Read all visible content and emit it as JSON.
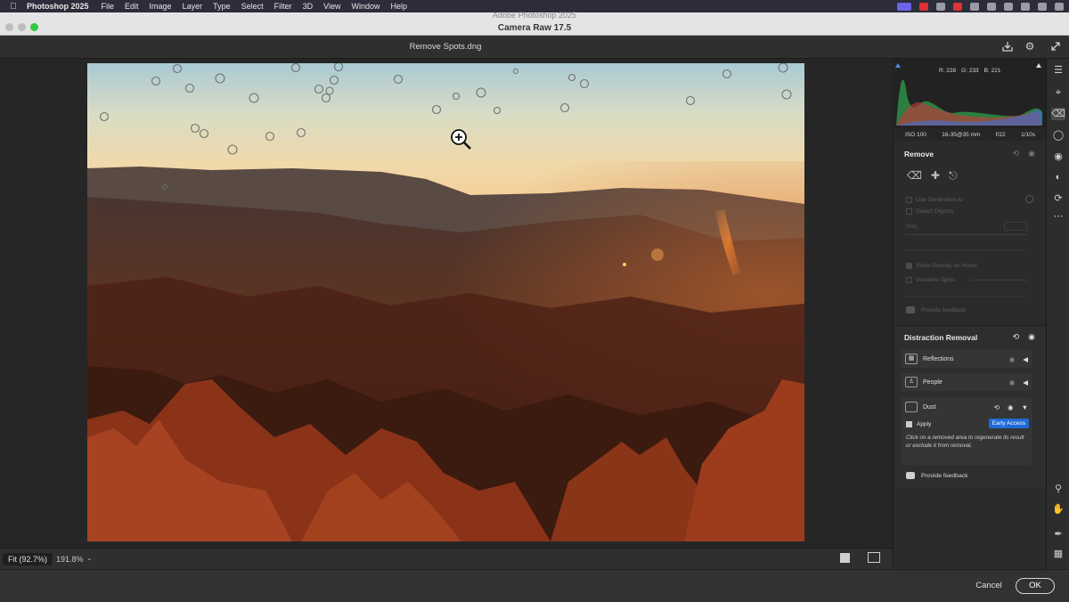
{
  "menubar": {
    "app": "Photoshop 2025",
    "items": [
      "File",
      "Edit",
      "Image",
      "Layer",
      "Type",
      "Select",
      "Filter",
      "3D",
      "View",
      "Window",
      "Help"
    ]
  },
  "window": {
    "ghost_title": "Adobe Photoshop 2025",
    "title": "Camera Raw 17.5"
  },
  "document": {
    "filename": "Remove Spots.dng"
  },
  "histogram": {
    "r": "R: 228",
    "g": "G: 233",
    "b": "B: 221"
  },
  "exif": {
    "iso": "ISO 100",
    "lens": "16-35@35 mm",
    "aperture": "f/22",
    "shutter": "1/10s"
  },
  "remove": {
    "title": "Remove",
    "use_generative_ai": "Use Generative AI",
    "detect_objects": "Detect Objects",
    "size_label": "Size",
    "show_overlay": "Show Overlay on Hover",
    "visualize_spots": "Visualize Spots",
    "feedback": "Provide feedback"
  },
  "distraction_removal": {
    "title": "Distraction Removal",
    "items": [
      {
        "label": "Reflections"
      },
      {
        "label": "People"
      }
    ],
    "dust": {
      "label": "Dust",
      "apply": "Apply",
      "badge": "Early Access",
      "note": "Click on a removed area to regenerate its result or exclude it from removal."
    },
    "feedback": "Provide feedback"
  },
  "zoom": {
    "fit": "Fit (92.7%)",
    "level": "191.8%"
  },
  "footer": {
    "cancel": "Cancel",
    "ok": "OK"
  },
  "colors": {
    "accent": "#1f6bd6",
    "panel": "#2b2b2b"
  }
}
